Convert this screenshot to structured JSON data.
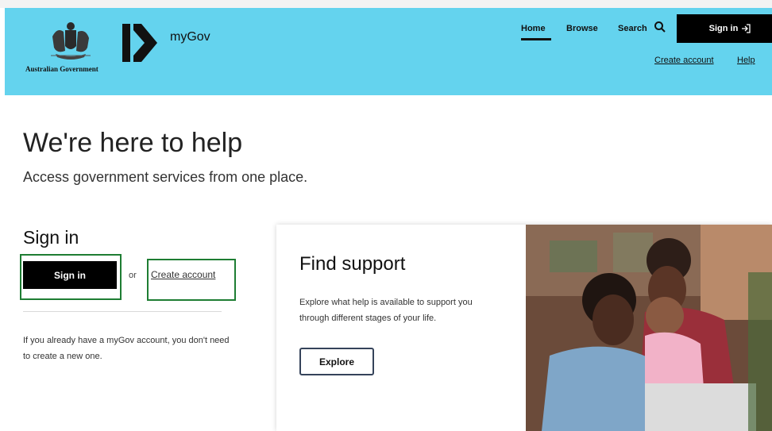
{
  "header": {
    "crest_text": "Australian Government",
    "brand": "myGov",
    "nav": {
      "home": "Home",
      "browse": "Browse",
      "search": "Search",
      "signin": "Sign in"
    },
    "links": {
      "create_account": "Create account",
      "help": "Help"
    },
    "colors": {
      "background": "#64d3ee",
      "button": "#000000"
    }
  },
  "main": {
    "title": "We're here to help",
    "subtitle": "Access government services from one place."
  },
  "signin": {
    "heading": "Sign in",
    "button": "Sign in",
    "or": "or",
    "create_account": "Create account",
    "note": "If you already have a myGov account, you don't need to create a new one.",
    "highlight_color": "#1e7d33"
  },
  "support": {
    "title": "Find support",
    "text": "Explore what help is available to support you through different stages of your life.",
    "button": "Explore"
  },
  "icons": [
    "coat-of-arms-icon",
    "mygov-logo-icon",
    "search-icon",
    "sign-in-arrow-icon"
  ]
}
